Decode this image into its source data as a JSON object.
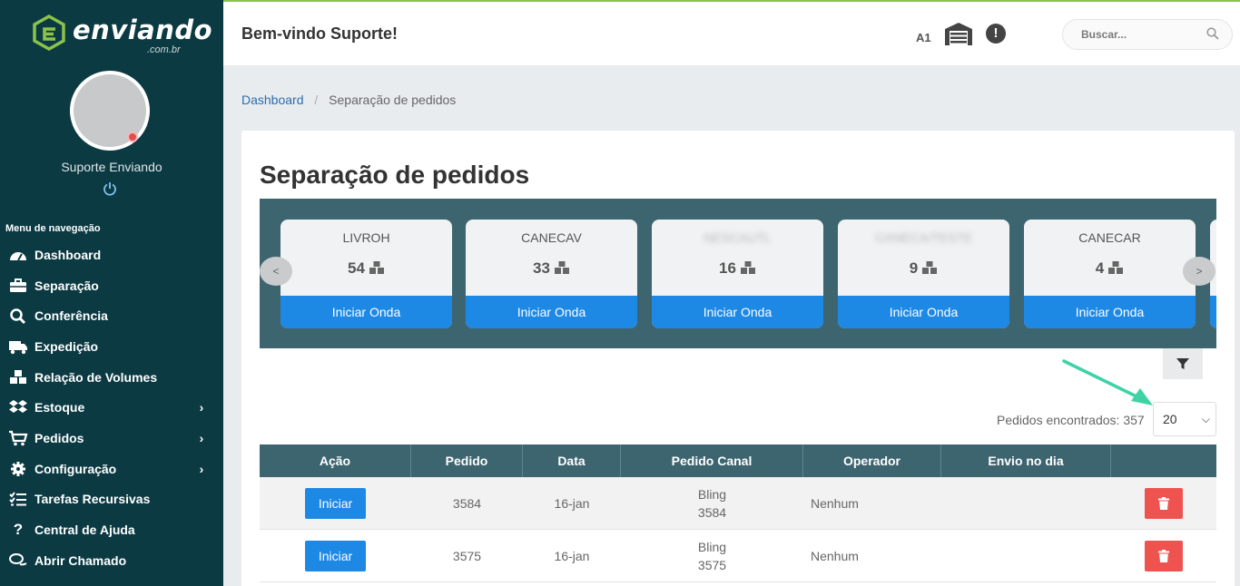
{
  "brand": {
    "name": "enviando",
    "sub": ".com.br"
  },
  "user": {
    "name": "Suporte Enviando"
  },
  "nav": {
    "title": "Menu de navegação",
    "items": [
      {
        "label": "Dashboard",
        "icon": "dashboard-icon",
        "chevron": false
      },
      {
        "label": "Separação",
        "icon": "briefcase-icon",
        "chevron": false
      },
      {
        "label": "Conferência",
        "icon": "search-icon",
        "chevron": false
      },
      {
        "label": "Expedição",
        "icon": "truck-icon",
        "chevron": false
      },
      {
        "label": "Relação de Volumes",
        "icon": "cubes-icon",
        "chevron": false
      },
      {
        "label": "Estoque",
        "icon": "dropbox-icon",
        "chevron": true
      },
      {
        "label": "Pedidos",
        "icon": "cart-icon",
        "chevron": true
      },
      {
        "label": "Configuração",
        "icon": "gear-icon",
        "chevron": true
      },
      {
        "label": "Tarefas Recursivas",
        "icon": "tasks-icon",
        "chevron": false
      },
      {
        "label": "Central de Ajuda",
        "icon": "question-icon",
        "chevron": false
      },
      {
        "label": "Abrir Chamado",
        "icon": "chat-icon",
        "chevron": false
      }
    ]
  },
  "header": {
    "welcome": "Bem-vindo Suporte!",
    "store_code": "A1",
    "alert_symbol": "!",
    "search_placeholder": "Buscar..."
  },
  "breadcrumb": {
    "home": "Dashboard",
    "sep": "/",
    "current": "Separação de pedidos"
  },
  "page": {
    "title": "Separação de pedidos"
  },
  "carousel": {
    "prev": "<",
    "next": ">",
    "button_label": "Iniciar Onda",
    "cards": [
      {
        "name": "LIVROH",
        "count": "54",
        "blurred": false
      },
      {
        "name": "CANECAV",
        "count": "33",
        "blurred": false
      },
      {
        "name": "NESCAUTL",
        "count": "16",
        "blurred": true
      },
      {
        "name": "CANECA/TESTE",
        "count": "9",
        "blurred": true
      },
      {
        "name": "CANECAR",
        "count": "4",
        "blurred": false
      }
    ]
  },
  "results": {
    "found_label": "Pedidos encontrados: 357",
    "page_size": "20"
  },
  "table": {
    "headers": [
      "Ação",
      "Pedido",
      "Data",
      "Pedido Canal",
      "Operador",
      "Envio no dia",
      ""
    ],
    "start_label": "Iniciar",
    "rows": [
      {
        "pedido": "3584",
        "data": "16-jan",
        "canal": "Bling",
        "canal_id": "3584",
        "operador": "Nenhum",
        "envio": ""
      },
      {
        "pedido": "3575",
        "data": "16-jan",
        "canal": "Bling",
        "canal_id": "3575",
        "operador": "Nenhum",
        "envio": ""
      }
    ]
  },
  "colors": {
    "sidebar": "#0b3a43",
    "accent": "#1e88e5",
    "table_header": "#3d6570",
    "danger": "#ef5350",
    "annotation": "#3ed3a6"
  }
}
